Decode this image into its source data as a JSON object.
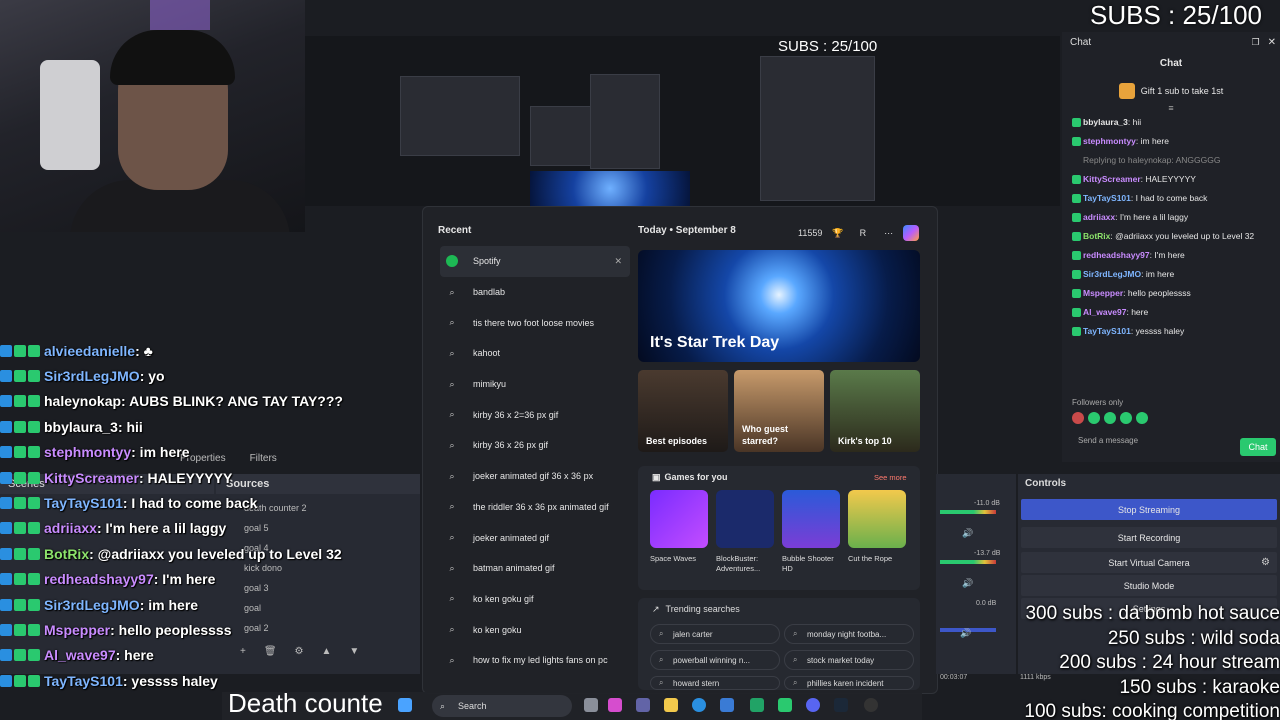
{
  "overlay": {
    "subs_top": "SUBS : 25/100",
    "subs_nested": "SUBS : 25/100",
    "death_counter": "Death counte",
    "goals": [
      "300 subs : da bomb hot sauce",
      "250 subs : wild soda",
      "200 subs : 24 hour stream",
      "150 subs : karaoke",
      "100 subs: cooking competition"
    ]
  },
  "left_chat": [
    {
      "user": "alvieedanielle",
      "msg": ": ♣",
      "color": "#7fb6ff"
    },
    {
      "user": "Sir3rdLegJMO",
      "msg": ": yo",
      "color": "#7fb6ff"
    },
    {
      "user": "haleynokap",
      "msg": ": AUBS BLINK? ANG TAY TAY???",
      "color": "#ffffff"
    },
    {
      "user": "bbylaura_3",
      "msg": ": hii",
      "color": "#ffffff"
    },
    {
      "user": "stephmontyy",
      "msg": ": im here",
      "color": "#c98cff"
    },
    {
      "user": "KittyScreamer",
      "msg": ": HALEYYYYY",
      "color": "#c98cff"
    },
    {
      "user": "TayTayS101",
      "msg": ": I had to come back",
      "color": "#7fb6ff"
    },
    {
      "user": "adriiaxx",
      "msg": ": I'm here a lil laggy",
      "color": "#c98cff"
    },
    {
      "user": "BotRix",
      "msg": ": @adriiaxx you leveled up to Level 32",
      "color": "#8ce36b"
    },
    {
      "user": "redheadshayy97",
      "msg": ": I'm here",
      "color": "#c98cff"
    },
    {
      "user": "Sir3rdLegJMO",
      "msg": ": im here",
      "color": "#7fb6ff"
    },
    {
      "user": "Mspepper",
      "msg": ": hello peoplessss",
      "color": "#c98cff"
    },
    {
      "user": "Al_wave97",
      "msg": ": here",
      "color": "#c98cff"
    },
    {
      "user": "TayTayS101",
      "msg": ": yessss haley",
      "color": "#7fb6ff"
    }
  ],
  "obs": {
    "properties_label": "Properties",
    "filters_label": "Filters",
    "scenes_label": "Scenes",
    "sources_label": "Sources",
    "sources": [
      "death counter 2",
      "goal 5",
      "goal 4",
      "kick dono",
      "goal 3",
      "goal",
      "goal 2"
    ],
    "controls_label": "Controls",
    "controls": [
      "Stop Streaming",
      "Start Recording",
      "Start Virtual Camera",
      "Studio Mode",
      "Settings"
    ],
    "mixer_levels": [
      "-11.0 dB",
      "-13.7 dB",
      "0.0 dB"
    ],
    "bitrate": "1111 kbps",
    "timer": "00:03:07"
  },
  "start_menu": {
    "recent_label": "Recent",
    "recent": [
      {
        "label": "Spotify",
        "icon": "spotify-icon"
      },
      {
        "label": "bandlab",
        "icon": "search-icon"
      },
      {
        "label": "tis there two foot loose movies",
        "icon": "search-icon"
      },
      {
        "label": "kahoot",
        "icon": "search-icon"
      },
      {
        "label": "mimikyu",
        "icon": "search-icon"
      },
      {
        "label": "kirby 36 x 2=36 px gif",
        "icon": "search-icon"
      },
      {
        "label": "kirby 36 x 26 px gif",
        "icon": "search-icon"
      },
      {
        "label": "joeker animated gif 36 x 36 px",
        "icon": "search-icon"
      },
      {
        "label": "the riddler 36 x 36 px animated gif",
        "icon": "search-icon"
      },
      {
        "label": "joeker animated gif",
        "icon": "search-icon"
      },
      {
        "label": "batman animated gif",
        "icon": "search-icon"
      },
      {
        "label": "ko ken goku gif",
        "icon": "search-icon"
      },
      {
        "label": "ko ken goku",
        "icon": "search-icon"
      },
      {
        "label": "how to fix my led lights fans on pc",
        "icon": "search-icon"
      }
    ],
    "today_label": "Today",
    "date_label": "September 8",
    "points": "11559",
    "avatar_letter": "R",
    "hero_title": "It's Star Trek Day",
    "tiles": [
      "Best episodes",
      "Who guest starred?",
      "Kirk's top 10"
    ],
    "games_label": "Games for you",
    "see_more": "See more",
    "games": [
      "Space Waves",
      "BlockBuster: Adventures...",
      "Bubble Shooter HD",
      "Cut the Rope"
    ],
    "trending_label": "Trending searches",
    "trending": [
      "jalen carter",
      "monday night footba...",
      "powerball winning n...",
      "stock market today",
      "howard stern",
      "phillies karen incident"
    ]
  },
  "right_chat": {
    "window_title": "Chat",
    "header": "Chat",
    "gift_text": "Gift 1 sub to take 1st",
    "messages": [
      {
        "user": "bbylaura_3",
        "msg": ": hii",
        "color": "#e6e6e6"
      },
      {
        "user": "stephmontyy",
        "msg": ": im here",
        "color": "#c98cff"
      },
      {
        "user": "Replying to haleynokap: ANGGGGG",
        "msg": "",
        "color": "#888888"
      },
      {
        "user": "KittyScreamer",
        "msg": ": HALEYYYYY",
        "color": "#c98cff"
      },
      {
        "user": "TayTayS101",
        "msg": ": I had to come back",
        "color": "#7fb6ff"
      },
      {
        "user": "adriiaxx",
        "msg": ": I'm here a lil laggy",
        "color": "#c98cff"
      },
      {
        "user": "BotRix",
        "msg": ": @adriiaxx you leveled up to Level 32",
        "color": "#8ce36b"
      },
      {
        "user": "redheadshayy97",
        "msg": ": I'm here",
        "color": "#c98cff"
      },
      {
        "user": "Sir3rdLegJMO",
        "msg": ": im here",
        "color": "#7fb6ff"
      },
      {
        "user": "Mspepper",
        "msg": ": hello peoplessss",
        "color": "#c98cff"
      },
      {
        "user": "Al_wave97",
        "msg": ": here",
        "color": "#c98cff"
      },
      {
        "user": "TayTayS101",
        "msg": ": yessss haley",
        "color": "#7fb6ff"
      }
    ],
    "followers_only": "Followers only",
    "send_placeholder": "Send a message",
    "chat_button": "Chat"
  },
  "taskbar": {
    "search_label": "Search"
  },
  "colors": {
    "accent_blue": "#3d57c9",
    "bits_green": "#2ac96f",
    "chat_purple": "#9147ff",
    "star_trek_blue": "#1447a8"
  }
}
